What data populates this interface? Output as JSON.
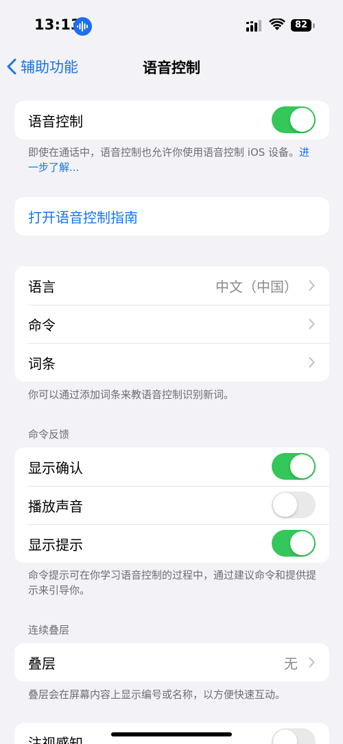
{
  "status": {
    "time": "13:13",
    "battery": "82"
  },
  "nav": {
    "back_label": "辅助功能",
    "title": "语音控制"
  },
  "voice_control": {
    "label": "语音控制",
    "enabled": true,
    "footer_text": "即使在通话中，语音控制也允许你使用语音控制 iOS 设备。",
    "learn_more": "进一步了解..."
  },
  "guide": {
    "label": "打开语音控制指南"
  },
  "language_group": {
    "rows": [
      {
        "label": "语言",
        "value": "中文（中国）"
      },
      {
        "label": "命令"
      },
      {
        "label": "词条"
      }
    ],
    "footer": "你可以通过添加词条来教语音控制识别新词。"
  },
  "feedback": {
    "header": "命令反馈",
    "rows": [
      {
        "label": "显示确认",
        "enabled": true
      },
      {
        "label": "播放声音",
        "enabled": false
      },
      {
        "label": "显示提示",
        "enabled": true
      }
    ],
    "footer": "命令提示可在你学习语音控制的过程中，通过建议命令和提供提示来引导你。"
  },
  "overlay": {
    "header": "连续叠层",
    "label": "叠层",
    "value": "无",
    "footer": "叠层会在屏幕内容上显示编号或名称，以方便快速互动。"
  },
  "attention": {
    "label": "注视感知",
    "enabled": false
  },
  "colors": {
    "accent": "#1a73e8",
    "toggle_on": "#34c759",
    "toggle_off": "#e9e9ea",
    "background": "#f2f2f7"
  }
}
